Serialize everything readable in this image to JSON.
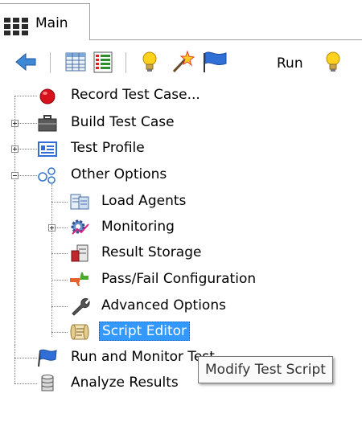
{
  "tab": {
    "label": "Main"
  },
  "toolbar": {
    "run_label": "Run"
  },
  "tree": {
    "record": "Record Test Case...",
    "build": "Build Test Case",
    "profile": "Test Profile",
    "other": "Other Options",
    "load_agents": "Load Agents",
    "monitoring": "Monitoring",
    "result_storage": "Result Storage",
    "passfail": "Pass/Fail Configuration",
    "advanced": "Advanced Options",
    "script_editor": "Script Editor",
    "run_monitor": "Run and Monitor Test",
    "analyze": "Analyze Results"
  },
  "tooltip": {
    "text": "Modify Test Script"
  },
  "colors": {
    "selection": "#3399ff",
    "tree_lines": "#808080"
  }
}
